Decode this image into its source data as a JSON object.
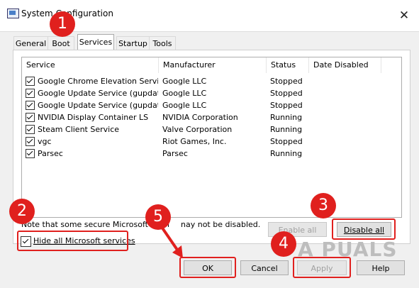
{
  "window": {
    "title": "System Configuration",
    "close_glyph": "✕"
  },
  "tabs": [
    {
      "label": "General"
    },
    {
      "label": "Boot"
    },
    {
      "label": "Services"
    },
    {
      "label": "Startup"
    },
    {
      "label": "Tools"
    }
  ],
  "columns": {
    "service": "Service",
    "manufacturer": "Manufacturer",
    "status": "Status",
    "date_disabled": "Date Disabled"
  },
  "services": [
    {
      "service": "Google Chrome Elevation Servic...",
      "manufacturer": "Google LLC",
      "status": "Stopped",
      "checked": true
    },
    {
      "service": "Google Update Service (gupdate)",
      "manufacturer": "Google LLC",
      "status": "Stopped",
      "checked": true
    },
    {
      "service": "Google Update Service (gupdatem)",
      "manufacturer": "Google LLC",
      "status": "Stopped",
      "checked": true
    },
    {
      "service": "NVIDIA Display Container LS",
      "manufacturer": "NVIDIA Corporation",
      "status": "Running",
      "checked": true
    },
    {
      "service": "Steam Client Service",
      "manufacturer": "Valve Corporation",
      "status": "Running",
      "checked": true
    },
    {
      "service": "vgc",
      "manufacturer": "Riot Games, Inc.",
      "status": "Stopped",
      "checked": true
    },
    {
      "service": "Parsec",
      "manufacturer": "Parsec",
      "status": "Running",
      "checked": true
    }
  ],
  "note": "Note that some secure Microsoft servi",
  "note_tail": "nay not be disabled.",
  "enable_all": "Enable all",
  "disable_all": "Disable all",
  "hide_ms": {
    "label": "Hide all Microsoft services",
    "checked": true
  },
  "buttons": {
    "ok": "OK",
    "cancel": "Cancel",
    "apply": "Apply",
    "help": "Help"
  },
  "badges": [
    "1",
    "2",
    "3",
    "4",
    "5"
  ],
  "watermark": "A  PUALS",
  "colors": {
    "highlight": "#e0201e"
  }
}
